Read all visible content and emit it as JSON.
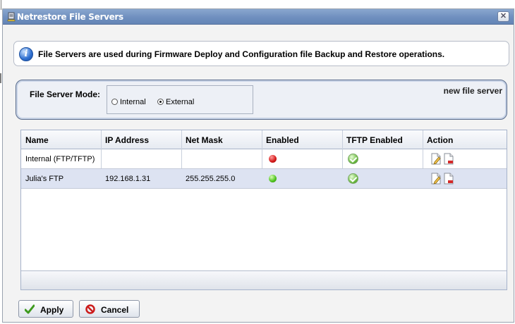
{
  "window": {
    "title": "Netrestore File Servers",
    "close_symbol": "✕"
  },
  "info": {
    "icon": "info-icon",
    "text": "File Servers are used during Firmware Deploy and Configuration file Backup and Restore operations."
  },
  "mode": {
    "label": "File Server Mode:",
    "options": [
      {
        "label": "Internal",
        "selected": false
      },
      {
        "label": "External",
        "selected": true
      }
    ],
    "new_server_link": "new file server"
  },
  "table": {
    "columns": [
      "Name",
      "IP Address",
      "Net Mask",
      "Enabled",
      "TFTP Enabled",
      "Action"
    ],
    "rows": [
      {
        "name": "Internal (FTP/TFTP)",
        "ip": "",
        "mask": "",
        "enabled": "red",
        "tftp": "check",
        "actions": [
          "edit-icon",
          "delete-icon"
        ]
      },
      {
        "name": "Julia's FTP",
        "ip": "192.168.1.31",
        "mask": "255.255.255.0",
        "enabled": "green",
        "tftp": "check",
        "actions": [
          "edit-icon",
          "delete-icon"
        ]
      }
    ]
  },
  "buttons": {
    "apply": "Apply",
    "cancel": "Cancel"
  },
  "colors": {
    "title_bar": "#6f8fbf",
    "selected_row": "#dde3f2",
    "status_red": "#d31818",
    "status_green": "#4cc21c"
  }
}
